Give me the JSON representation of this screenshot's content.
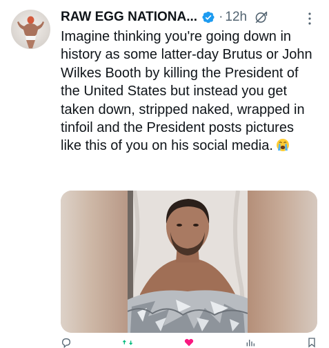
{
  "tweet": {
    "author": {
      "display_name": "RAW EGG NATIONA...",
      "verified": true,
      "avatar_icon": "profile-avatar"
    },
    "separator": "·",
    "timestamp": "12h",
    "icons": {
      "verified": "verified-badge-icon",
      "grok": "grok-icon",
      "more": "more-options-icon"
    },
    "text": "Imagine thinking you're going down in history as some latter-day Brutus or John Wilkes Booth by killing the President of the United States but instead you get taken down, stripped naked, wrapped in tinfoil and the President posts pictures like this of you on his social media.",
    "emoji": "loudly-crying-face-emoji",
    "media": {
      "type": "photo",
      "description_icon": "photo"
    },
    "actions": [
      {
        "icon": "reply-icon",
        "count": ""
      },
      {
        "icon": "repost-icon",
        "count": ""
      },
      {
        "icon": "like-icon",
        "count": ""
      },
      {
        "icon": "views-icon",
        "count": ""
      },
      {
        "icon": "bookmark-icon",
        "count": ""
      }
    ]
  },
  "colors": {
    "text": "#0f1419",
    "secondary": "#536471",
    "verified_blue": "#1d9bf0",
    "background": "#ffffff"
  }
}
